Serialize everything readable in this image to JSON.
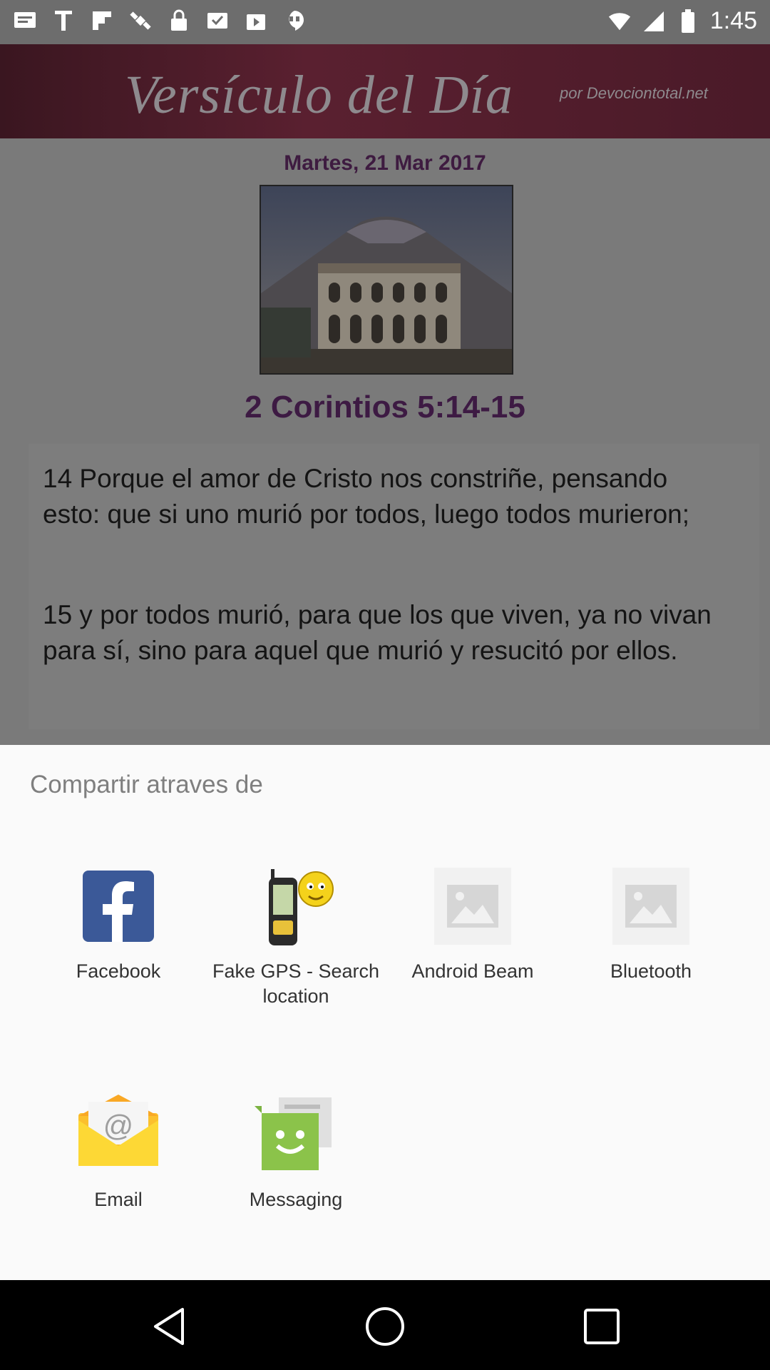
{
  "status_bar": {
    "time": "1:45",
    "left_icons": [
      "message-icon",
      "text-icon",
      "flipboard-icon",
      "satellite-icon",
      "lock-icon",
      "inbox-icon",
      "play-store-icon",
      "hangouts-icon"
    ],
    "right_icons": [
      "wifi-icon",
      "signal-icon",
      "battery-icon"
    ]
  },
  "app": {
    "banner_title": "Versículo del Día",
    "banner_sub": "por Devociontotal.net",
    "date": "Martes, 21 Mar 2017",
    "reference": "2 Corintios 5:14-15",
    "verses": [
      "14 Porque el amor de Cristo nos constriñe, pensando esto: que si uno murió por todos, luego todos murieron;",
      "15 y por todos murió, para que los que viven, ya no vivan para sí, sino para aquel que murió y resucitó por ellos."
    ]
  },
  "share_sheet": {
    "title": "Compartir atraves de",
    "items": [
      {
        "label": "Facebook",
        "icon": "facebook-icon"
      },
      {
        "label": "Fake GPS - Search location",
        "icon": "gps-icon"
      },
      {
        "label": "Android Beam",
        "icon": "image-placeholder-icon"
      },
      {
        "label": "Bluetooth",
        "icon": "image-placeholder-icon"
      },
      {
        "label": "Email",
        "icon": "email-icon"
      },
      {
        "label": "Messaging",
        "icon": "messaging-icon"
      }
    ]
  },
  "nav_bar": {
    "buttons": [
      "back-icon",
      "home-icon",
      "recents-icon"
    ]
  },
  "colors": {
    "facebook_blue": "#3b5998",
    "sheet_bg": "#fafafa",
    "date_color": "#3e1b40",
    "messaging_green": "#8bc34a",
    "email_yellow": "#fbc02d"
  }
}
